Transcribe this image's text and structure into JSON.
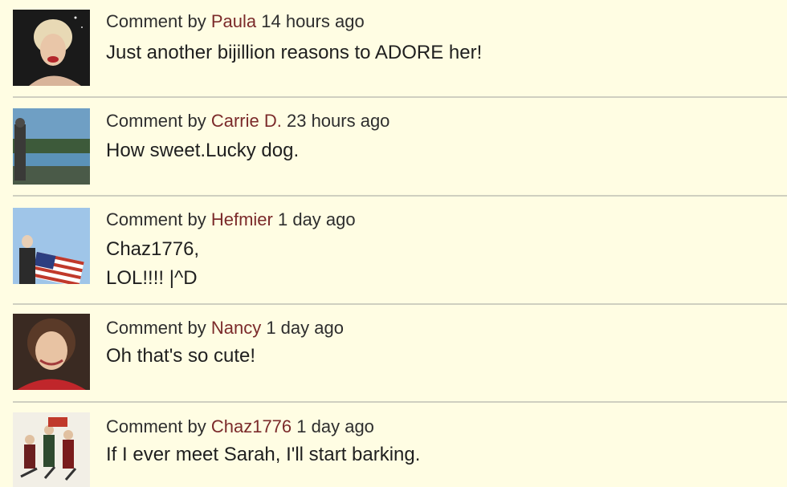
{
  "comments": [
    {
      "prefix": "Comment by",
      "author": "Paula",
      "time": "14 hours ago",
      "text": "Just another bijillion reasons to ADORE her!",
      "avatar": "avatar-marilyn"
    },
    {
      "prefix": "Comment by",
      "author": "Carrie D.",
      "time": "23 hours ago",
      "text": "How sweet.Lucky dog.",
      "avatar": "avatar-landscape"
    },
    {
      "prefix": "Comment by",
      "author": "Hefmier",
      "time": "1 day ago",
      "text": "Chaz1776,\nLOL!!!! |^D",
      "avatar": "avatar-flag"
    },
    {
      "prefix": "Comment by",
      "author": "Nancy",
      "time": "1 day ago",
      "text": "Oh that's so cute!",
      "avatar": "avatar-portrait"
    },
    {
      "prefix": "Comment by",
      "author": "Chaz1776",
      "time": "1 day ago",
      "text": "If I ever meet Sarah, I'll start barking.",
      "avatar": "avatar-revolutionaries"
    }
  ],
  "colors": {
    "background": "#fffde3",
    "author": "#7b2a2a",
    "divider": "#cfcfc0"
  }
}
